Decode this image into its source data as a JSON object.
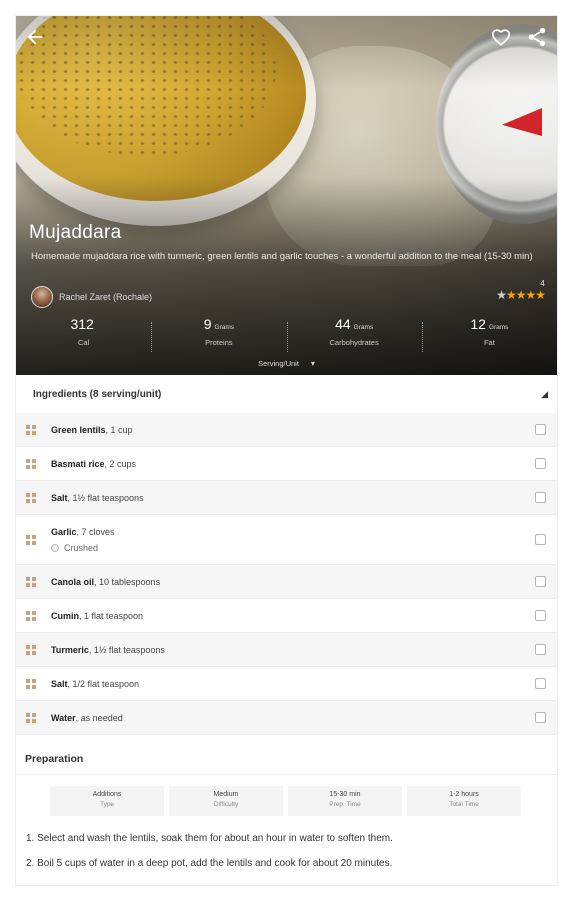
{
  "hero": {
    "title": "Mujaddara",
    "description": "Homemade mujaddara rice with turmeric, green lentils and garlic touches - a wonderful addition to the meal (15-30 min)",
    "author": "Rachel Zaret (Rochale)",
    "rating_count": "4",
    "rating_stars": 4
  },
  "icons": {
    "back": "back-arrow-icon",
    "favorite": "heart-icon",
    "share": "share-icon"
  },
  "nutrition": [
    {
      "value": "312",
      "unit": "",
      "label": "Cal"
    },
    {
      "value": "9",
      "unit": "Grams",
      "label": "Proteins"
    },
    {
      "value": "44",
      "unit": "Grams",
      "label": "Carbohydrates"
    },
    {
      "value": "12",
      "unit": "Grams",
      "label": "Fat"
    }
  ],
  "serving_label": "Serving/Unit",
  "ingredients": {
    "header": "Ingredients (8 serving/unit)",
    "items": [
      {
        "name": "Green lentils",
        "amount": ", 1 cup",
        "note": ""
      },
      {
        "name": "Basmati rice",
        "amount": ", 2 cups",
        "note": ""
      },
      {
        "name": "Salt",
        "amount": ", 1½ flat teaspoons",
        "note": ""
      },
      {
        "name": "Garlic",
        "amount": ", 7 cloves",
        "note": "Crushed"
      },
      {
        "name": "Canola oil",
        "amount": ", 10 tablespoons",
        "note": ""
      },
      {
        "name": "Cumin",
        "amount": ", 1 flat teaspoon",
        "note": ""
      },
      {
        "name": "Turmeric",
        "amount": ", 1½ flat teaspoons",
        "note": ""
      },
      {
        "name": "Salt",
        "amount": ", 1/2 flat teaspoon",
        "note": ""
      },
      {
        "name": "Water",
        "amount": ", as needed",
        "note": ""
      }
    ]
  },
  "preparation": {
    "header": "Preparation",
    "chips": [
      {
        "value": "Additions",
        "label": "Type"
      },
      {
        "value": "Medium",
        "label": "Difficulty"
      },
      {
        "value": "15-30 min",
        "label": "Prep. Time"
      },
      {
        "value": "1-2 hours",
        "label": "Total Time"
      }
    ],
    "steps": [
      "1. Select and wash the lentils, soak them for about an hour in water to soften them.",
      "2. Boil 5 cups of water in a deep pot, add the lentils and cook for about 20 minutes."
    ]
  }
}
